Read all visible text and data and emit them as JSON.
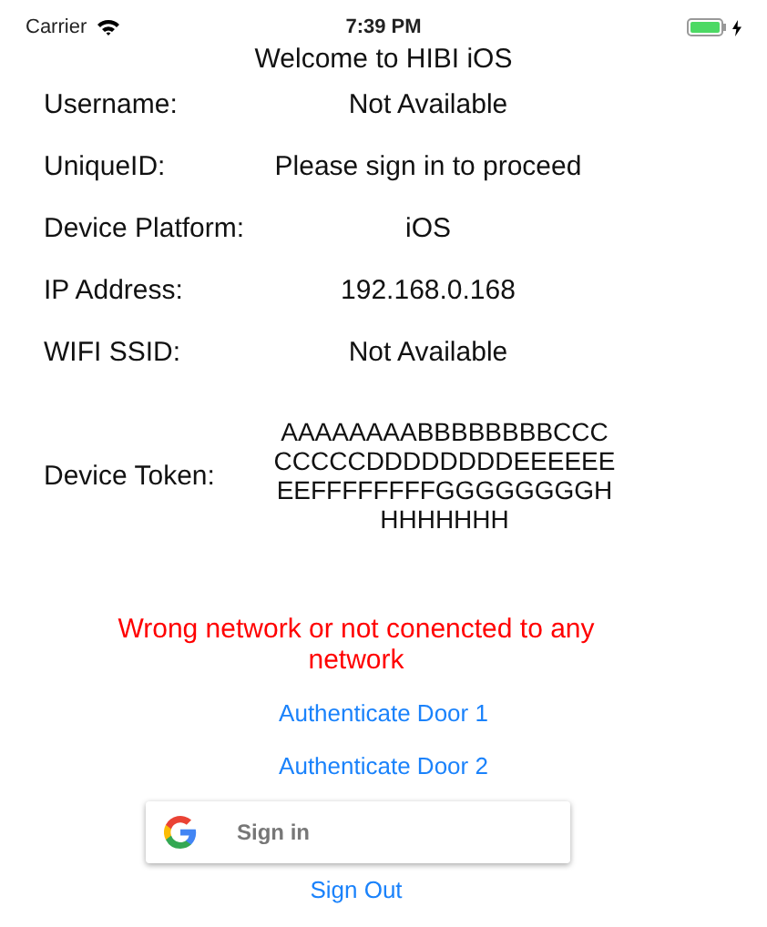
{
  "status_bar": {
    "carrier": "Carrier",
    "time": "7:39 PM",
    "charging": true
  },
  "title": "Welcome to HIBI iOS",
  "fields": [
    {
      "label": "Username:",
      "value": "Not Available"
    },
    {
      "label": "UniqueID:",
      "value": "Please sign in to proceed"
    },
    {
      "label": "Device Platform:",
      "value": "iOS"
    },
    {
      "label": "IP Address:",
      "value": "192.168.0.168"
    },
    {
      "label": "WIFI SSID:",
      "value": "Not Available"
    }
  ],
  "token": {
    "label": "Device Token:",
    "value": "AAAAAAAABBBBBBBBCCCCCCCCDDDDDDDDEEEEEEEEFFFFFFFFGGGGGGGGHHHHHHHH"
  },
  "error": "Wrong network or not conencted to any network",
  "links": [
    "Authenticate Door 1",
    "Authenticate Door 2"
  ],
  "google_button": "Sign in",
  "sign_out": "Sign Out"
}
